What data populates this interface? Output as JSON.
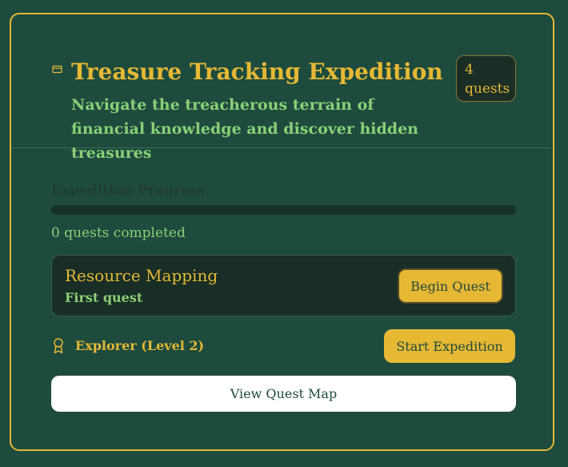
{
  "header": {
    "icon": "card-icon",
    "title": "Treasure Tracking Expedition",
    "subtitle": "Navigate the treacherous terrain of financial knowledge and discover hidden treasures",
    "badge_count": "4",
    "badge_unit": "quests"
  },
  "progress": {
    "label": "Expedition Progress",
    "completed_fraction": 0,
    "status_text": "0 quests completed"
  },
  "quest": {
    "name": "Resource Mapping",
    "subtitle": "First quest",
    "button_label": "Begin Quest"
  },
  "rank": {
    "icon": "award-icon",
    "label": "Explorer (Level 2)"
  },
  "actions": {
    "start_label": "Start Expedition",
    "map_label": "View Quest Map"
  },
  "colors": {
    "background": "#1d4b3e",
    "accent_gold": "#e6b834",
    "text_green": "#8ccf74",
    "panel_dark": "#182e26",
    "white": "#ffffff"
  }
}
